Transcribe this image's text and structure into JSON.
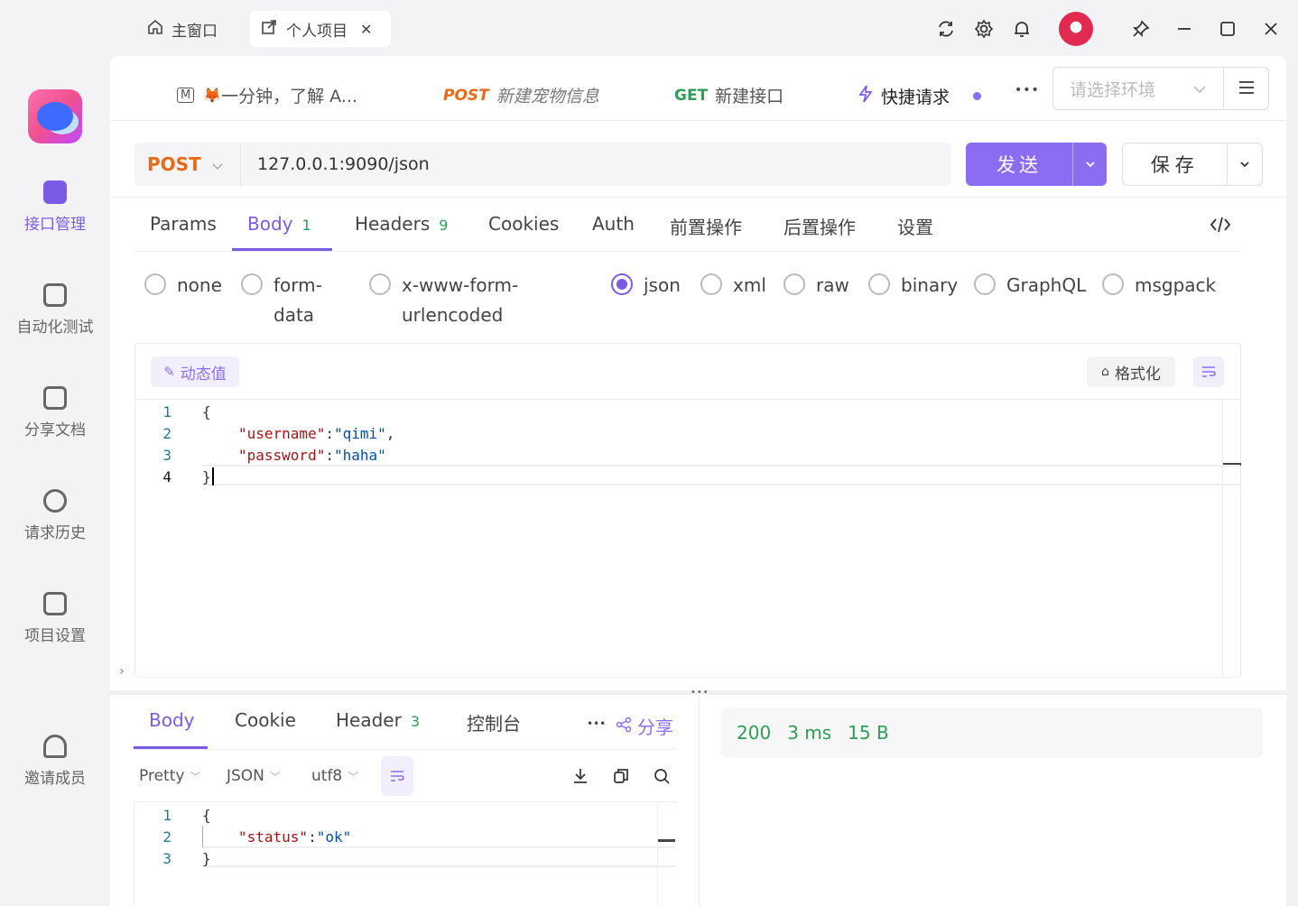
{
  "window": {
    "tabs": [
      {
        "label": "主窗口",
        "icon": "home-icon"
      },
      {
        "label": "个人项目",
        "icon": "external-link-icon",
        "close": "✕"
      }
    ],
    "controls": [
      "refresh-icon",
      "gear-icon",
      "bell-icon",
      "pin-icon",
      "minimize-icon",
      "maximize-icon",
      "close-icon"
    ]
  },
  "sidebar": {
    "items": [
      {
        "label": "接口管理",
        "icon": "api-manage-icon",
        "active": true
      },
      {
        "label": "自动化测试",
        "icon": "automation-icon"
      },
      {
        "label": "分享文档",
        "icon": "share-doc-icon"
      },
      {
        "label": "请求历史",
        "icon": "history-icon"
      },
      {
        "label": "项目设置",
        "icon": "project-settings-icon"
      },
      {
        "label": "邀请成员",
        "icon": "invite-member-icon"
      }
    ]
  },
  "request_tabs": [
    {
      "icon_text": "M",
      "emoji": "🦊",
      "label": "一分钟，了解 A..."
    },
    {
      "method": "POST",
      "label": "新建宠物信息",
      "method_color": "#e86a18"
    },
    {
      "method": "GET",
      "label": "新建接口",
      "method_color": "#2f9e55"
    },
    {
      "label": "快捷请求",
      "icon": "lightning-icon",
      "active": true
    }
  ],
  "more_label": "•••",
  "env_select": {
    "placeholder": "请选择环境"
  },
  "request": {
    "method": "POST",
    "url": "127.0.0.1:9090/json",
    "send_label": "发送",
    "save_label": "保存"
  },
  "subtabs": [
    {
      "label": "Params"
    },
    {
      "label": "Body",
      "badge": "1",
      "active": true
    },
    {
      "label": "Headers",
      "badge": "9"
    },
    {
      "label": "Cookies"
    },
    {
      "label": "Auth"
    },
    {
      "label": "前置操作"
    },
    {
      "label": "后置操作"
    },
    {
      "label": "设置"
    }
  ],
  "body_types": [
    {
      "label": "none"
    },
    {
      "label": "form-\ndata"
    },
    {
      "label": "x-www-form-\nurlencoded"
    },
    {
      "label": "json",
      "checked": true
    },
    {
      "label": "xml"
    },
    {
      "label": "raw"
    },
    {
      "label": "binary"
    },
    {
      "label": "GraphQL"
    },
    {
      "label": "msgpack"
    }
  ],
  "editor": {
    "dynamic_label": "动态值",
    "format_label": "格式化",
    "lines": [
      {
        "n": "1",
        "text": "{"
      },
      {
        "n": "2",
        "key": "\"username\"",
        "sep": ":",
        "val": "\"qimi\"",
        "tail": ","
      },
      {
        "n": "3",
        "key": "\"password\"",
        "sep": ":",
        "val": "\"haha\"",
        "tail": ""
      },
      {
        "n": "4",
        "text": "}"
      }
    ]
  },
  "response": {
    "tabs": [
      {
        "label": "Body",
        "active": true
      },
      {
        "label": "Cookie"
      },
      {
        "label": "Header",
        "badge": "3"
      },
      {
        "label": "控制台"
      }
    ],
    "share_label": "分享",
    "pretty": "Pretty",
    "format": "JSON",
    "encoding": "utf8",
    "lines": [
      {
        "n": "1",
        "text": "{"
      },
      {
        "n": "2",
        "key": "\"status\"",
        "sep": ": ",
        "val": "\"ok\""
      },
      {
        "n": "3",
        "text": "}"
      }
    ],
    "status_code": "200",
    "time": "3 ms",
    "size": "15 B"
  }
}
